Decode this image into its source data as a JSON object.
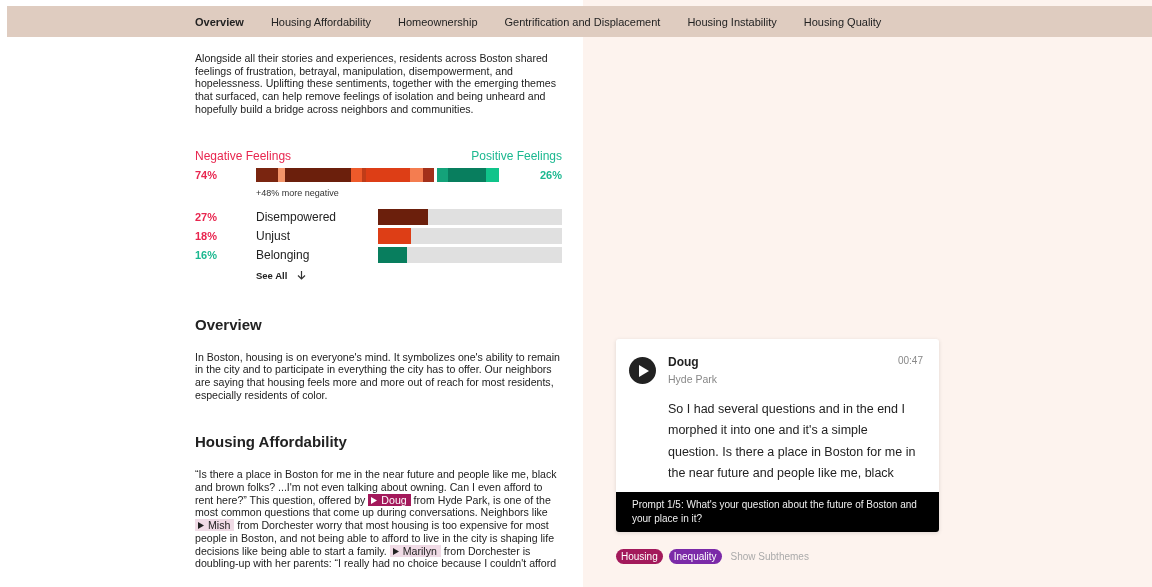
{
  "nav": [
    {
      "label": "Overview",
      "selected": true
    },
    {
      "label": "Housing Affordability",
      "selected": false
    },
    {
      "label": "Homeownership",
      "selected": false
    },
    {
      "label": "Gentrification and Displacement",
      "selected": false
    },
    {
      "label": "Housing Instability",
      "selected": false
    },
    {
      "label": "Housing Quality",
      "selected": false
    }
  ],
  "intro": "Alongside all their stories and experiences, residents across Boston shared feelings of frustration, betrayal, manipulation, disempowerment, and hopelessness. Uplifting these sentiments, together with the emerging themes that surfaced, can help remove feelings of isolation and being unheard and hopefully build a bridge across neighbors and communities.",
  "sentiment": {
    "negative_label": "Negative Feelings",
    "positive_label": "Positive Feelings",
    "negative_percent": "74%",
    "positive_percent": "26%",
    "note": "+48% more negative",
    "negative_segments": [
      {
        "color": "#7a2510"
      },
      {
        "color": "#f4956a"
      },
      {
        "color": "#6b1f0c"
      },
      {
        "color": "#ee5a2a"
      },
      {
        "color": "#c03c18"
      },
      {
        "color": "#dd3e16"
      },
      {
        "color": "#f47d50"
      },
      {
        "color": "#a3301a"
      }
    ],
    "positive_segments": [
      {
        "color": "#14a37a"
      },
      {
        "color": "#087e5e"
      },
      {
        "color": "#10c48a"
      }
    ],
    "feelings": [
      {
        "kind": "negative",
        "percent": "27%",
        "name": "Disempowered",
        "color": "#6b1f0c",
        "level": 0.27
      },
      {
        "kind": "negative",
        "percent": "18%",
        "name": "Unjust",
        "color": "#dd3e16",
        "level": 0.18
      },
      {
        "kind": "positive",
        "percent": "16%",
        "name": "Belonging",
        "color": "#087e5e",
        "level": 0.16
      }
    ],
    "see_all": "See All"
  },
  "sections": [
    {
      "heading": "Overview",
      "parts": [
        {
          "kind": "text",
          "text": "In Boston, housing is on everyone's mind. It symbolizes one's ability to remain in the city and to participate in everything the city has to offer. Our neighbors are saying that housing feels more and more out of reach for most residents, especially residents of color."
        }
      ]
    },
    {
      "heading": "Housing Affordability",
      "parts": [
        {
          "kind": "text",
          "text": "“Is there a place in Boston for me in the near future and people like me, black and brown folks? ...I'm not even talking about owning. Can I even afford to rent here?” This question, offered by "
        },
        {
          "kind": "speaker",
          "label": "Doug",
          "selected": true
        },
        {
          "kind": "text",
          "text": " from Hyde Park, is one of the most common questions that come up during conversations. Neighbors like "
        },
        {
          "kind": "speaker",
          "label": "Mish",
          "selected": false
        },
        {
          "kind": "text",
          "text": " from Dorchester worry that most housing is too expensive for most people in Boston, and not being able to afford to live in the city is shaping life decisions like being able to start a family. "
        },
        {
          "kind": "speaker",
          "label": "Marilyn",
          "selected": false
        },
        {
          "kind": "text",
          "text": " from Dorchester is doubling-up with her parents: “I really had no choice because I couldn't afford"
        }
      ]
    }
  ],
  "player": {
    "name": "Doug",
    "place": "Hyde Park",
    "time": "00:47",
    "transcript": "So I had several questions and in the end I morphed it into one and it's a simple question. Is there a place in Boston for me in the near future and people like me, black",
    "prompt": "Prompt 1/5: What's your question about the future of Boston and your place in it?",
    "tags": [
      {
        "label": "Housing",
        "color": "#a3195b"
      },
      {
        "label": "Inequality",
        "color": "#7b2aa8"
      }
    ],
    "subthemes": "Show Subthemes"
  }
}
